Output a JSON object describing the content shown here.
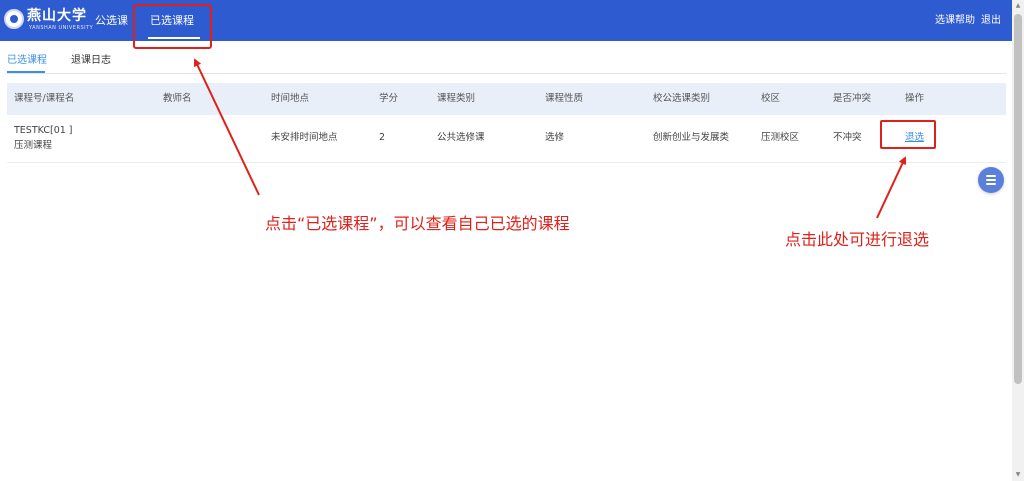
{
  "brand": {
    "name_cn": "燕山大学",
    "name_en": "YANSHAN UNIVERSITY",
    "logo_icon": "university-emblem-icon"
  },
  "nav": {
    "items": [
      "公选课",
      "已选课程"
    ],
    "active": "已选课程"
  },
  "header_right": {
    "help": "选课帮助",
    "logout": "退出"
  },
  "tabs": [
    "已选课程",
    "退课日志"
  ],
  "table": {
    "headers": [
      "课程号/课程名",
      "教师名",
      "时间地点",
      "学分",
      "课程类别",
      "课程性质",
      "校公选课类别",
      "校区",
      "是否冲突",
      "操作"
    ],
    "rows": [
      {
        "course_code": "TESTKC[01 ]",
        "course_name": "压测课程",
        "teacher": "",
        "time_place": "未安排时间地点",
        "credit": "2",
        "category": "公共选修课",
        "nature": "选修",
        "public_category": "创新创业与发展类",
        "campus": "压测校区",
        "conflict": "不冲突",
        "action": "退选"
      }
    ]
  },
  "annotations": {
    "note1": "点击“已选课程”，可以查看自己已选的课程",
    "note2": "点击此处可进行退选"
  },
  "colors": {
    "header_bg": "#2e5bcf",
    "accent": "#3a8ee6",
    "annotation": "#e0201a"
  },
  "floating_button_icon": "menu-list-icon"
}
